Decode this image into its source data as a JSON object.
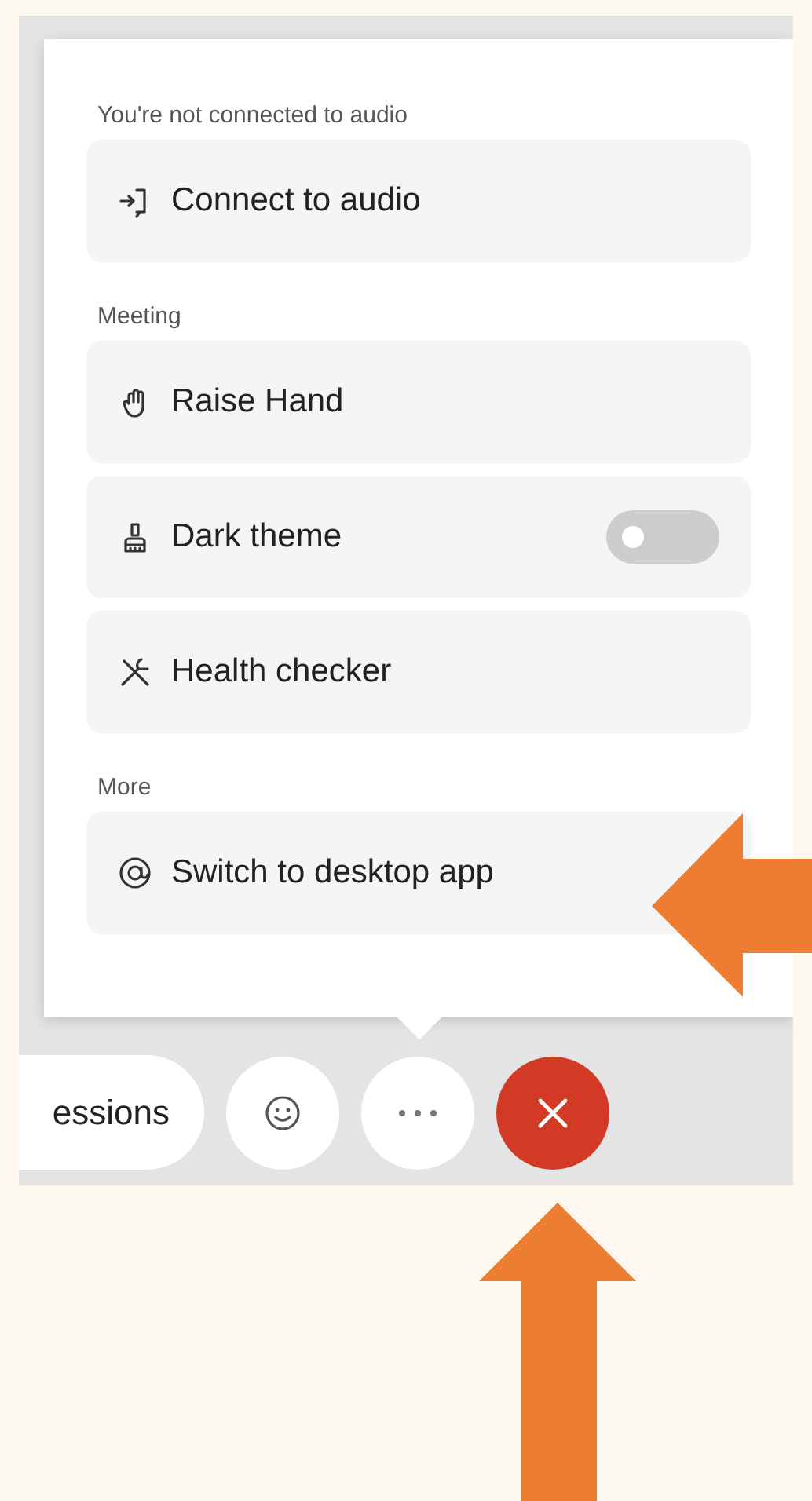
{
  "menu": {
    "sections": [
      {
        "label": "You're not connected to audio",
        "items": [
          {
            "kind": "action",
            "label": "Connect to audio"
          }
        ]
      },
      {
        "label": "Meeting",
        "items": [
          {
            "kind": "action",
            "label": "Raise Hand"
          },
          {
            "kind": "toggle",
            "label": "Dark theme",
            "on": false
          },
          {
            "kind": "action",
            "label": "Health checker"
          }
        ]
      },
      {
        "label": "More",
        "items": [
          {
            "kind": "action",
            "label": "Switch to desktop app"
          }
        ]
      }
    ]
  },
  "toolbar": {
    "partial_button": "essions"
  }
}
